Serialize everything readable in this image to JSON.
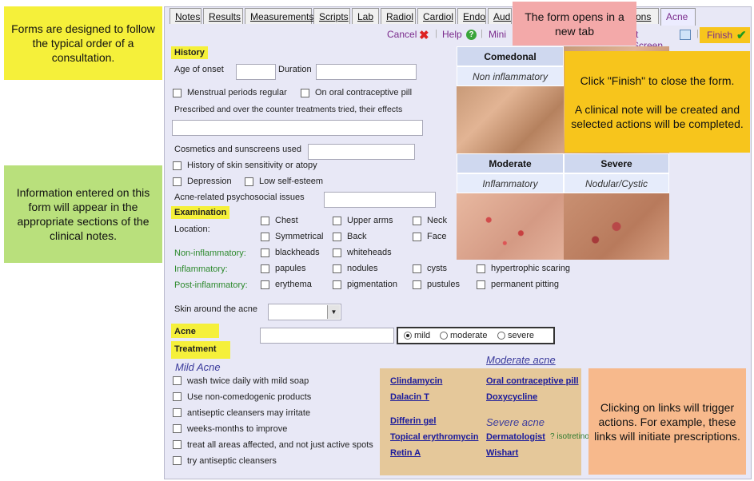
{
  "tabs": [
    "Notes",
    "Results",
    "Measurements",
    "Scripts",
    "Lab",
    "Radiol",
    "Cardiol",
    "Endo",
    "Audio",
    "ons",
    "Acne"
  ],
  "toolbar": {
    "cancel": "Cancel",
    "help": "Help",
    "minimize": "Mini",
    "print_screen": "rt Screen",
    "finish": "Finish"
  },
  "callouts": {
    "forms_order": "Forms are designed to follow the typical order of a consultation.",
    "info_entered": "Information entered on this form will appear in the appropriate sections of the clinical notes.",
    "new_tab": "The form opens in a new tab",
    "finish_title": "Click \"Finish\" to close the form.",
    "finish_body": "A clinical note will be created and selected actions will be completed.",
    "links": "Clicking on links will trigger actions. For example, these links will initiate prescriptions."
  },
  "history": {
    "title": "History",
    "age_onset": "Age of onset",
    "duration": "Duration",
    "menstrual": "Menstrual periods regular",
    "ocp": "On oral contraceptive pill",
    "prescribed": "Prescribed and over the counter treatments tried, their effects",
    "cosmetics": "Cosmetics and sunscreens used",
    "skin_sens": "History of skin sensitivity or atopy",
    "depression": "Depression",
    "low_esteem": "Low self-esteem",
    "psychosocial": "Acne-related psychosocial issues"
  },
  "examination": {
    "title": "Examination",
    "location": "Location:",
    "loc_items": [
      "Chest",
      "Upper arms",
      "Neck",
      "Symmetrical",
      "Back",
      "Face"
    ],
    "non_inflam": "Non-inflammatory:",
    "non_inflam_items": [
      "blackheads",
      "whiteheads"
    ],
    "inflam": "Inflammatory:",
    "inflam_items": [
      "papules",
      "nodules",
      "cysts",
      "hypertrophic scaring"
    ],
    "post_inflam": "Post-inflammatory:",
    "post_items": [
      "erythema",
      "pigmentation",
      "pustules",
      "permanent pitting"
    ],
    "skin_around": "Skin around the acne"
  },
  "acne": {
    "title": "Acne",
    "severity": [
      "mild",
      "moderate",
      "severe"
    ],
    "selected": "mild"
  },
  "treatment": {
    "title": "Treatment",
    "mild_title": "Mild Acne",
    "mild_items": [
      "wash twice daily with mild soap",
      "Use non-comedogenic products",
      "antiseptic cleansers may irritate",
      "weeks-months to improve",
      "treat all areas affected, and not just active spots",
      "try antiseptic cleansers"
    ],
    "moderate_title": "Moderate acne",
    "severe_title": "Severe acne",
    "links_col1": [
      "Clindamycin",
      "Dalacin T",
      "Differin gel",
      "Topical erythromycin",
      "Retin A"
    ],
    "links_col2a": [
      "Oral contraceptive pill",
      "Doxycycline"
    ],
    "links_col2b": [
      "Dermatologist",
      "Wishart"
    ],
    "isotretinoin": "? isotretino"
  },
  "photos": {
    "comedonal": "Comedonal",
    "non_inflam": "Non inflammatory",
    "moderate": "Moderate",
    "inflammatory": "Inflammatory",
    "severe": "Severe",
    "nodular": "Nodular/Cystic"
  }
}
